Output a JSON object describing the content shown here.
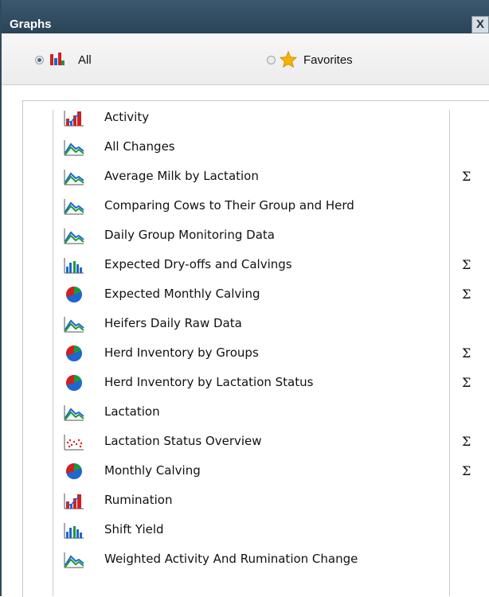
{
  "window": {
    "title": "Graphs",
    "close_label": "X"
  },
  "filter": {
    "all_label": "All",
    "favorites_label": "Favorites",
    "selected": "All"
  },
  "colors": {
    "title_bar": "#2b4457",
    "accent_blue": "#1e66d0",
    "accent_red": "#d12020",
    "accent_green": "#1b9a3a"
  },
  "graphs": [
    {
      "label": "Activity",
      "icon": "bar-chart-red-icon",
      "sum": ""
    },
    {
      "label": "All Changes",
      "icon": "line-chart-icon",
      "sum": ""
    },
    {
      "label": "Average Milk by Lactation",
      "icon": "line-chart-icon",
      "sum": "Σ"
    },
    {
      "label": "Comparing Cows to Their Group and Herd",
      "icon": "line-chart-icon",
      "sum": ""
    },
    {
      "label": "Daily Group Monitoring Data",
      "icon": "line-chart-icon",
      "sum": ""
    },
    {
      "label": "Expected Dry-offs and Calvings",
      "icon": "bar-chart-blue-icon",
      "sum": "Σ"
    },
    {
      "label": "Expected Monthly Calving",
      "icon": "pie-chart-icon",
      "sum": "Σ"
    },
    {
      "label": "Heifers Daily Raw Data",
      "icon": "line-chart-icon",
      "sum": ""
    },
    {
      "label": "Herd Inventory by Groups",
      "icon": "pie-chart-icon",
      "sum": "Σ"
    },
    {
      "label": "Herd Inventory by Lactation Status",
      "icon": "pie-chart-icon",
      "sum": "Σ"
    },
    {
      "label": "Lactation",
      "icon": "line-chart-icon",
      "sum": ""
    },
    {
      "label": "Lactation Status Overview",
      "icon": "scatter-chart-icon",
      "sum": "Σ"
    },
    {
      "label": "Monthly Calving",
      "icon": "pie-chart-icon",
      "sum": "Σ"
    },
    {
      "label": "Rumination",
      "icon": "bar-chart-red-icon",
      "sum": ""
    },
    {
      "label": "Shift Yield",
      "icon": "bar-chart-blue-icon",
      "sum": ""
    },
    {
      "label": "Weighted Activity And Rumination Change",
      "icon": "line-chart-icon",
      "sum": ""
    }
  ]
}
